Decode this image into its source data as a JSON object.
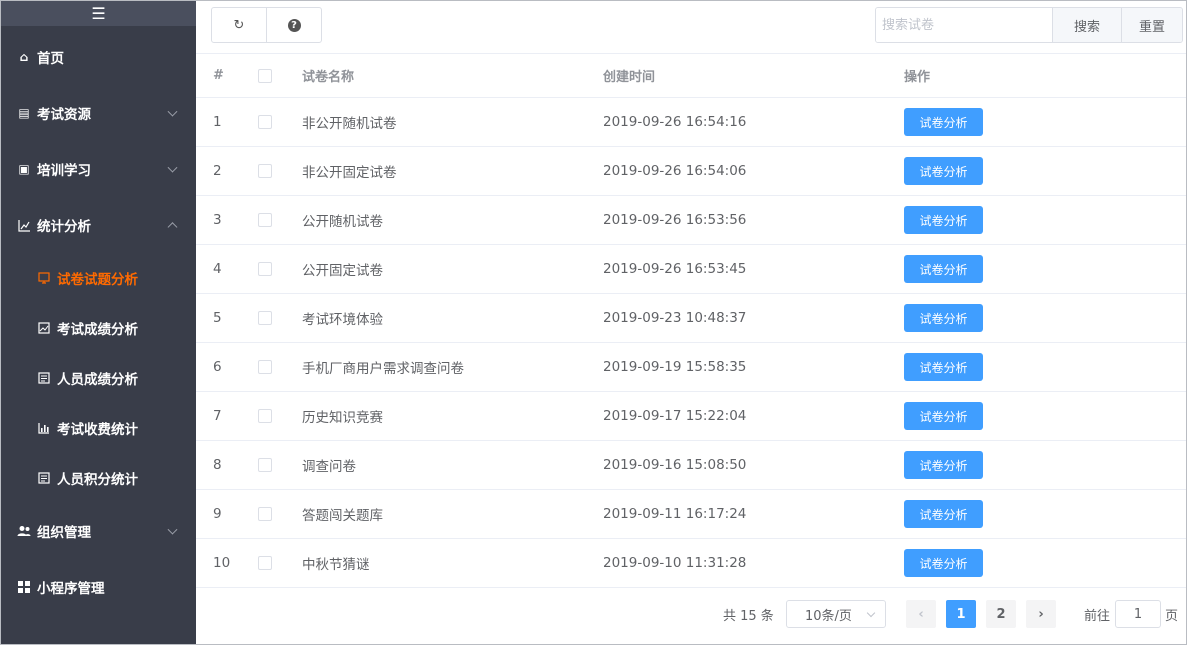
{
  "sidebar": {
    "toggle_icon": "☰",
    "menu": [
      {
        "label": "首页",
        "icon": "home-icon",
        "glyph": "⌂",
        "chevron": ""
      },
      {
        "label": "考试资源",
        "icon": "document-icon",
        "glyph": "▤",
        "chevron": "down"
      },
      {
        "label": "培训学习",
        "icon": "monitor-icon",
        "glyph": "▣",
        "chevron": "down"
      },
      {
        "label": "统计分析",
        "icon": "chart-icon",
        "glyph": "📈",
        "chevron": "up"
      }
    ],
    "submenu": [
      {
        "label": "试卷试题分析",
        "icon": "analysis-icon",
        "glyph": "▢",
        "active": true
      },
      {
        "label": "考试成绩分析",
        "icon": "image-icon",
        "glyph": "▧",
        "active": false
      },
      {
        "label": "人员成绩分析",
        "icon": "report-icon",
        "glyph": "▤",
        "active": false
      },
      {
        "label": "考试收费统计",
        "icon": "bar-chart-icon",
        "glyph": "▥",
        "active": false
      },
      {
        "label": "人员积分统计",
        "icon": "report-icon",
        "glyph": "▤",
        "active": false
      }
    ],
    "menu_bottom": [
      {
        "label": "组织管理",
        "icon": "users-icon",
        "glyph": "👥",
        "chevron": "down"
      },
      {
        "label": "小程序管理",
        "icon": "grid-icon",
        "glyph": "▦",
        "chevron": ""
      }
    ]
  },
  "toolbar": {
    "refresh_glyph": "↻",
    "help_glyph": "?"
  },
  "search": {
    "placeholder": "搜索试卷",
    "search_label": "搜索",
    "reset_label": "重置"
  },
  "table": {
    "headers": {
      "index": "#",
      "name": "试卷名称",
      "created": "创建时间",
      "action": "操作"
    },
    "rows": [
      {
        "index": "1",
        "name": "非公开随机试卷",
        "created": "2019-09-26 16:54:16",
        "action": "试卷分析"
      },
      {
        "index": "2",
        "name": "非公开固定试卷",
        "created": "2019-09-26 16:54:06",
        "action": "试卷分析"
      },
      {
        "index": "3",
        "name": "公开随机试卷",
        "created": "2019-09-26 16:53:56",
        "action": "试卷分析"
      },
      {
        "index": "4",
        "name": "公开固定试卷",
        "created": "2019-09-26 16:53:45",
        "action": "试卷分析"
      },
      {
        "index": "5",
        "name": "考试环境体验",
        "created": "2019-09-23 10:48:37",
        "action": "试卷分析"
      },
      {
        "index": "6",
        "name": "手机厂商用户需求调查问卷",
        "created": "2019-09-19 15:58:35",
        "action": "试卷分析"
      },
      {
        "index": "7",
        "name": "历史知识竞赛",
        "created": "2019-09-17 15:22:04",
        "action": "试卷分析"
      },
      {
        "index": "8",
        "name": "调查问卷",
        "created": "2019-09-16 15:08:50",
        "action": "试卷分析"
      },
      {
        "index": "9",
        "name": "答题闯关题库",
        "created": "2019-09-11 16:17:24",
        "action": "试卷分析"
      },
      {
        "index": "10",
        "name": "中秋节猜谜",
        "created": "2019-09-10 11:31:28",
        "action": "试卷分析"
      }
    ]
  },
  "pagination": {
    "total_text": "共 15 条",
    "page_size": "10条/页",
    "prev_glyph": "‹",
    "next_glyph": "›",
    "pages": [
      "1",
      "2"
    ],
    "current_page": "1",
    "goto_label": "前往",
    "goto_value": "1",
    "page_unit": "页"
  },
  "colors": {
    "sidebar_bg": "#393d49",
    "active_menu": "#ff6a00",
    "primary": "#409eff"
  }
}
